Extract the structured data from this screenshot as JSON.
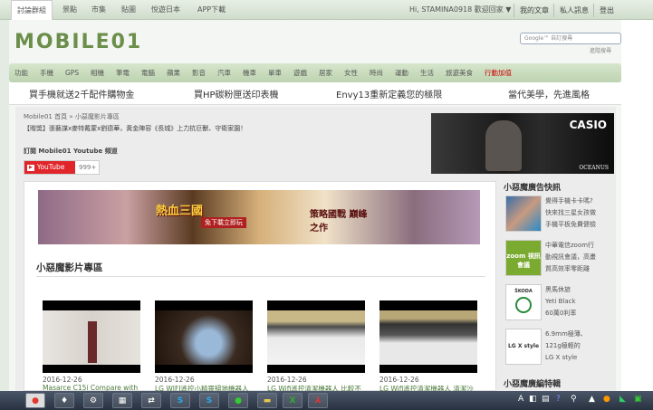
{
  "topbar": {
    "tabs": [
      "討論群組",
      "景點",
      "市集",
      "貼圖",
      "悅遊日本",
      "APP下載"
    ],
    "user": "Hi, STAMINA0918 歡迎回家 ▼",
    "links": [
      "我的文章",
      "私人訊息",
      "登出"
    ]
  },
  "header": {
    "logo": "MOBILE01",
    "search_placeholder": "Google™ 自訂搜尋",
    "advanced_search": "進階搜尋"
  },
  "nav": {
    "items": [
      "功能",
      "手機",
      "GPS",
      "相機",
      "筆電",
      "電腦",
      "蘋果",
      "影音",
      "汽車",
      "機車",
      "單車",
      "遊戲",
      "居家",
      "女性",
      "時尚",
      "運動",
      "生活",
      "旅遊美食",
      "行動加值"
    ],
    "highlight_color": "#cc0000"
  },
  "promo": [
    "買手機就送2千配件購物金",
    "買HP碳粉匣送印表機",
    "Envy13重新定義您的極限",
    "當代美學，先進風格"
  ],
  "breadcrumb": {
    "home": "Mobile01 首頁",
    "sep": "»",
    "current": "小惡魔影片專區"
  },
  "notice": "【贈獎】張藝謀x麥特戴蒙x劉德華，黃金陣容《長城》上力抗巨獸、守衛家園！",
  "subscribe": {
    "label": "訂閱 Mobile01 Youtube 頻道",
    "button": "YouTube",
    "count": "999+"
  },
  "casio_ad": {
    "brand": "CASIO",
    "sub": "OCEANUS"
  },
  "banner_ad": {
    "left": "熱血三國",
    "badge": "免下載立即玩",
    "right": "策略國戰 巔峰之作"
  },
  "section": {
    "title": "小惡魔影片專區",
    "videos": [
      {
        "date": "2016-12-26",
        "title": "Masarce C15i Compare with"
      },
      {
        "date": "2016-12-26",
        "title": "LG WIFI遙控小精靈掃地機器人"
      },
      {
        "date": "2016-12-26",
        "title": "LG Wifi遙控清潔機器人 比較不"
      },
      {
        "date": "2016-12-26",
        "title": "LG Wifi遙控清潔機器人 清潔沙"
      }
    ]
  },
  "sidebar": {
    "title": "小惡魔廣告快訊",
    "ads": [
      {
        "logo": "",
        "lines": [
          "覺得手機卡卡嗎?",
          "快來找三星女孩做",
          "手機平板免費健檢"
        ]
      },
      {
        "logo": "zoom 視訊會議",
        "lines": [
          "中華電信zoom行",
          "動視訊會議，高畫",
          "質高效率零距離"
        ]
      },
      {
        "logo": "ŠKODA",
        "lines": [
          "黑馬休旅",
          "Yeti Black",
          "60萬0利率"
        ]
      },
      {
        "logo": "LG X style",
        "lines": [
          "6.9mm極薄、",
          "121g極輕的",
          "LG X style"
        ]
      }
    ],
    "title2": "小惡魔廣編特輯"
  },
  "taskbar": {
    "apps": [
      "chrome",
      "app",
      "network",
      "calculator",
      "network2",
      "skype",
      "skype2",
      "line",
      "explorer",
      "excel",
      "acrobat"
    ]
  }
}
